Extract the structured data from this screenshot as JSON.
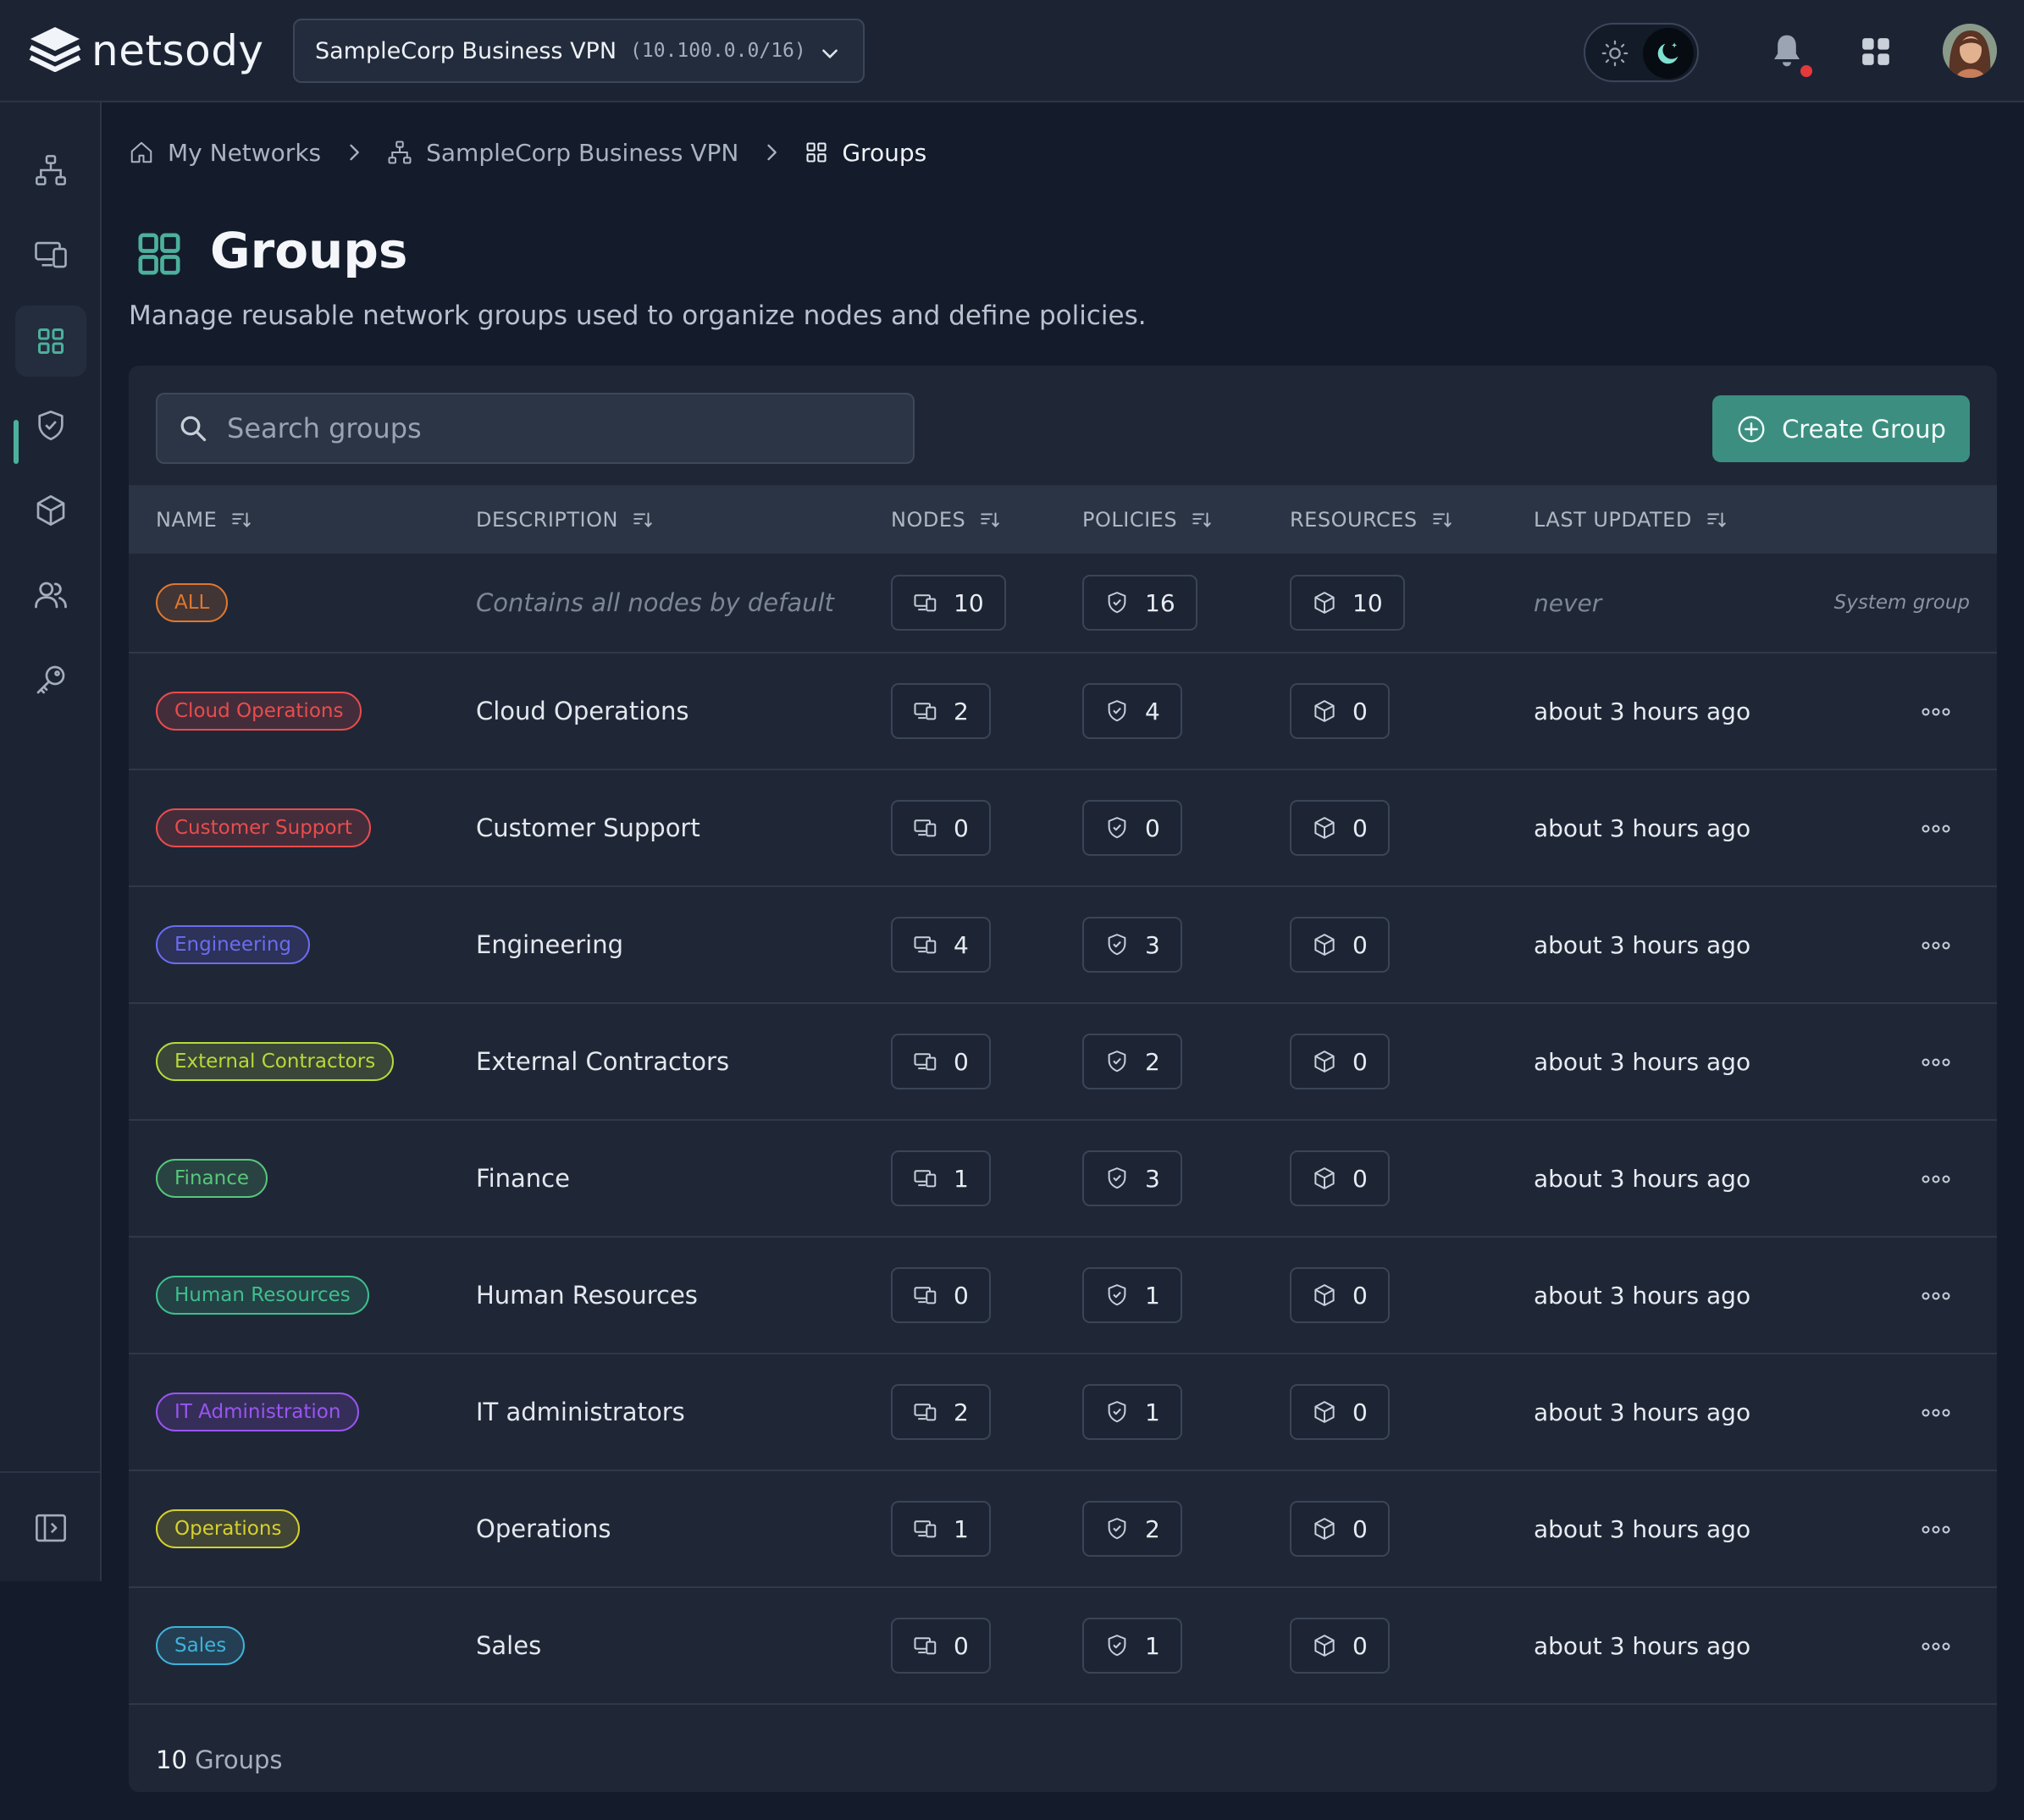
{
  "app": {
    "logo_text": "netsody"
  },
  "network_selector": {
    "name": "SampleCorp Business VPN",
    "cidr": "(10.100.0.0/16)"
  },
  "breadcrumb": [
    {
      "label": "My Networks",
      "icon": "home-icon"
    },
    {
      "label": "SampleCorp Business VPN",
      "icon": "network-icon"
    },
    {
      "label": "Groups",
      "icon": "grid-icon"
    }
  ],
  "page": {
    "title": "Groups",
    "subtitle": "Manage reusable network groups used to organize nodes and define policies."
  },
  "search": {
    "placeholder": "Search groups"
  },
  "create_button": {
    "label": "Create Group"
  },
  "columns": {
    "name": "NAME",
    "description": "DESCRIPTION",
    "nodes": "NODES",
    "policies": "POLICIES",
    "resources": "RESOURCES",
    "last_updated": "LAST UPDATED"
  },
  "rows": [
    {
      "name": "ALL",
      "description": "Contains all nodes by default",
      "nodes": "10",
      "policies": "16",
      "resources": "10",
      "updated": "never",
      "note": "System group",
      "color": "#e0782e"
    },
    {
      "name": "Cloud Operations",
      "description": "Cloud Operations",
      "nodes": "2",
      "policies": "4",
      "resources": "0",
      "updated": "about 3 hours ago",
      "color": "#ea4c4c"
    },
    {
      "name": "Customer Support",
      "description": "Customer Support",
      "nodes": "0",
      "policies": "0",
      "resources": "0",
      "updated": "about 3 hours ago",
      "color": "#ea4c4c"
    },
    {
      "name": "Engineering",
      "description": "Engineering",
      "nodes": "4",
      "policies": "3",
      "resources": "0",
      "updated": "about 3 hours ago",
      "color": "#6b6cf0"
    },
    {
      "name": "External Contractors",
      "description": "External Contractors",
      "nodes": "0",
      "policies": "2",
      "resources": "0",
      "updated": "about 3 hours ago",
      "color": "#b8d93a"
    },
    {
      "name": "Finance",
      "description": "Finance",
      "nodes": "1",
      "policies": "3",
      "resources": "0",
      "updated": "about 3 hours ago",
      "color": "#58c77a"
    },
    {
      "name": "Human Resources",
      "description": "Human Resources",
      "nodes": "0",
      "policies": "1",
      "resources": "0",
      "updated": "about 3 hours ago",
      "color": "#3fbf8c"
    },
    {
      "name": "IT Administration",
      "description": "IT administrators",
      "nodes": "2",
      "policies": "1",
      "resources": "0",
      "updated": "about 3 hours ago",
      "color": "#9a55f2"
    },
    {
      "name": "Operations",
      "description": "Operations",
      "nodes": "1",
      "policies": "2",
      "resources": "0",
      "updated": "about 3 hours ago",
      "color": "#d6d02e"
    },
    {
      "name": "Sales",
      "description": "Sales",
      "nodes": "0",
      "policies": "1",
      "resources": "0",
      "updated": "about 3 hours ago",
      "color": "#3fb3d9"
    }
  ],
  "footer": {
    "count": "10",
    "label": "Groups"
  },
  "sidebar": {
    "items": [
      {
        "icon": "network-icon"
      },
      {
        "icon": "devices-icon"
      },
      {
        "icon": "groups-icon",
        "active": true
      },
      {
        "icon": "shield-icon"
      },
      {
        "icon": "cube-icon"
      },
      {
        "icon": "users-icon"
      },
      {
        "icon": "key-icon"
      }
    ],
    "collapse_icon": "sidebar-toggle-icon"
  },
  "theme": {
    "accent": "#3c8f80",
    "active_indicator": "#4db09c",
    "notification_dot": "#e5393c"
  }
}
